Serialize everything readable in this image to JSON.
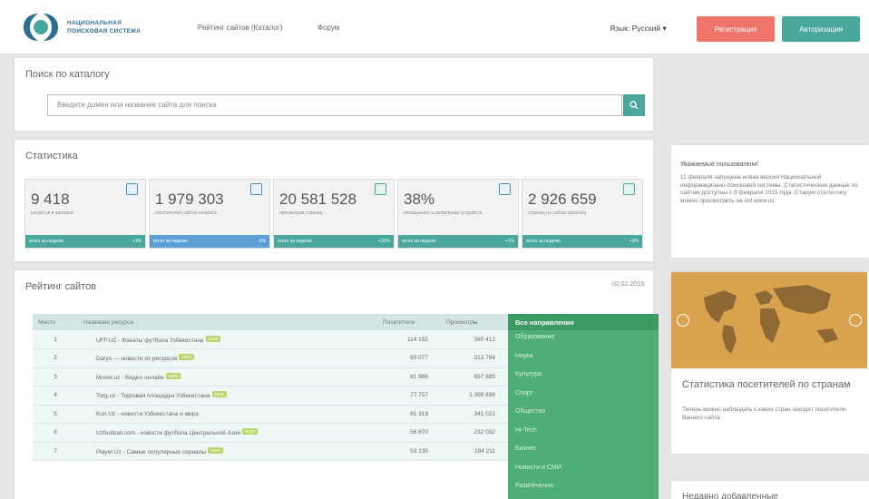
{
  "header": {
    "logo_line1": "НАЦИОНАЛЬНАЯ",
    "logo_line2": "ПОИСКОВАЯ СИСТЕМА",
    "nav": [
      "Рейтинг сайтов (Каталог)",
      "Форум"
    ],
    "language": "Язык: Русский ▾",
    "register_label": "Регистрация",
    "login_label": "Авторизация"
  },
  "search": {
    "title": "Поиск по каталогу",
    "placeholder": "Введите домен или название сайта для поиска"
  },
  "stats": {
    "title": "Статистика",
    "cards": [
      {
        "value": "9 418",
        "desc": "ресурсов в каталоге",
        "bar": "итого за неделю",
        "change": "+1%",
        "color": "#4aa79b"
      },
      {
        "value": "1 979 303",
        "desc": "посетителей сайтов каталога",
        "bar": "итого за неделю",
        "change": "-3%",
        "color": "#5b9fd6"
      },
      {
        "value": "20 581 528",
        "desc": "просмотров страниц",
        "bar": "итого за неделю",
        "change": "+22%",
        "color": "#4aa79b"
      },
      {
        "value": "38%",
        "desc": "посещаемость мобильных устройств",
        "bar": "итого за неделю",
        "change": "+1%",
        "color": "#4aa79b"
      },
      {
        "value": "2 926 659",
        "desc": "страниц на сайтах каталога",
        "bar": "итого за неделю",
        "change": "+3%",
        "color": "#4aa79b"
      }
    ]
  },
  "rating": {
    "title": "Рейтинг сайтов",
    "date": "02.02.2015",
    "columns": [
      "Место",
      "Название ресурса",
      "Посетители",
      "Просмотры"
    ],
    "rows": [
      {
        "place": "1",
        "name": "UFF.UZ - Фанаты футбола Узбекистана",
        "badge": "NEW",
        "visitors": "114 192",
        "views": "380 412"
      },
      {
        "place": "2",
        "name": "Daryo — новости из ресурсов",
        "badge": "NEW",
        "visitors": "93 077",
        "views": "313 784"
      },
      {
        "place": "3",
        "name": "Mover.uz - Видео онлайн",
        "badge": "NEW",
        "visitors": "81 986",
        "views": "697 885"
      },
      {
        "place": "4",
        "name": "Torg.uz - Торговая площадка Узбекистана",
        "badge": "NEW",
        "visitors": "77 757",
        "views": "1 398 898"
      },
      {
        "place": "5",
        "name": "Kun.Uz - новости Узбекистана и мира",
        "badge": "",
        "visitors": "81 319",
        "views": "341 021"
      },
      {
        "place": "6",
        "name": "Uzfootball.com - новости футбола Центральной Азии",
        "badge": "NEW",
        "visitors": "58 870",
        "views": "232 032"
      },
      {
        "place": "7",
        "name": "Player.Uz - Самые популярные сериалы",
        "badge": "NEW",
        "visitors": "53 135",
        "views": "194 211"
      }
    ],
    "directions_title": "Все направления",
    "directions": [
      "Образование",
      "Наука",
      "Культура",
      "Спорт",
      "Общество",
      "Hi-Tech",
      "Бизнес",
      "Новости и СМИ",
      "Развлечения"
    ]
  },
  "news": {
    "title": "Уважаемые пользователи!",
    "text": "11 февраля запущена новая версия Национальной информационно-поисковой системы. Статистические данные по сайтам доступны с 9 февраля 2015 года. Старую статистику можно просмотреть на old.www.uz."
  },
  "geo": {
    "title": "Статистика посетителей по странам",
    "text": "Теперь можно наблюдать с каких стран заходят посетители Вашего сайта."
  },
  "recent": {
    "title": "Недавно добавленные"
  }
}
